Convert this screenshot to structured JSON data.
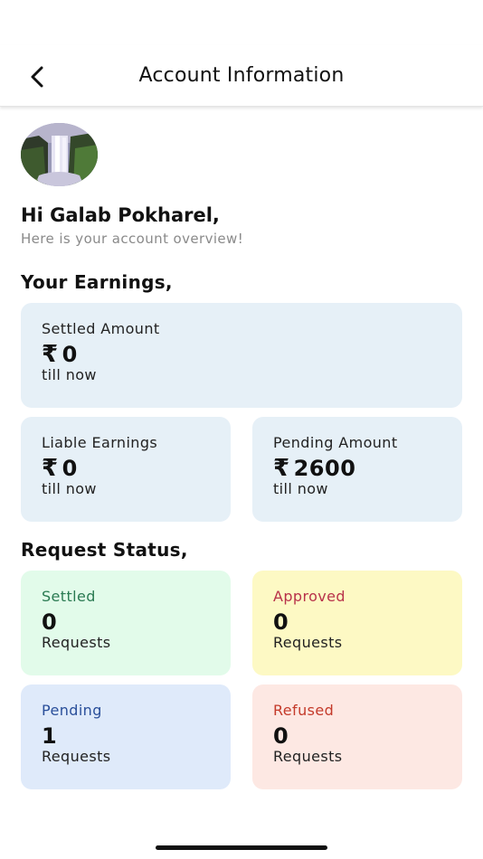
{
  "header": {
    "title": "Account Information",
    "back_icon": "chevron-left-icon"
  },
  "profile": {
    "greeting": "Hi Galab Pokharel,",
    "subtext": "Here is your account overview!"
  },
  "earnings": {
    "title": "Your Earnings,",
    "currency_symbol": "₹",
    "cards": [
      {
        "label": "Settled Amount",
        "value": "0",
        "sub": "till now"
      },
      {
        "label": "Liable Earnings",
        "value": "0",
        "sub": "till now"
      },
      {
        "label": "Pending Amount",
        "value": "2600",
        "sub": "till now"
      }
    ]
  },
  "request_status": {
    "title": "Request Status,",
    "cards": [
      {
        "label": "Settled",
        "count": "0",
        "sub": "Requests",
        "label_color": "#2a7a52",
        "bg_color": "#e2fbea"
      },
      {
        "label": "Approved",
        "count": "0",
        "sub": "Requests",
        "label_color": "#b8324a",
        "bg_color": "#fdf9c4"
      },
      {
        "label": "Pending",
        "count": "1",
        "sub": "Requests",
        "label_color": "#2a4f9a",
        "bg_color": "#dfeafa"
      },
      {
        "label": "Refused",
        "count": "0",
        "sub": "Requests",
        "label_color": "#c43a2a",
        "bg_color": "#fde8e3"
      }
    ]
  },
  "colors": {
    "earnings_card_bg": "#e6f0f7"
  }
}
